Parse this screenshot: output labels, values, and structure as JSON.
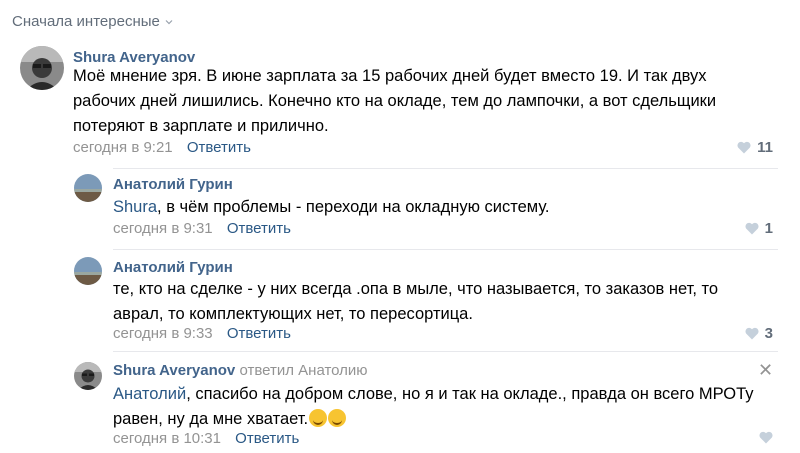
{
  "sort": {
    "label": "Сначала интересные"
  },
  "comments": [
    {
      "author": "Shura Averyanov",
      "lines": [
        "Моё мнение зря. В июне зарплата за 15 рабочих дней будет вместо 19. И так двух",
        "рабочих дней лишились. Конечно кто на окладе, тем до лампочки, а вот сдельщики",
        "потеряют в зарплате и прилично."
      ],
      "time": "сегодня в 9:21",
      "reply": "Ответить",
      "likes": "11"
    },
    {
      "author": "Анатолий Гурин",
      "mention": "Shura",
      "text": ", в чём проблемы - переходи на окладную систему.",
      "time": "сегодня в 9:31",
      "reply": "Ответить",
      "likes": "1"
    },
    {
      "author": "Анатолий Гурин",
      "lines": [
        "те, кто на сделке - у них всегда .опа в мыле, что называется, то заказов нет, то",
        "аврал, то комплектующих нет, то пересортица."
      ],
      "time": "сегодня в 9:33",
      "reply": "Ответить",
      "likes": "3"
    },
    {
      "author": "Shura Averyanov",
      "replied_to": "ответил Анатолию",
      "mention": "Анатолий",
      "line1_rest": ", спасибо на добром слове, но я и так на окладе., правда он всего МРОТу",
      "line2": "равен, ну да мне хватает.",
      "time": "сегодня в 10:31",
      "reply": "Ответить"
    }
  ],
  "icons": {
    "like": "heart-icon",
    "close": "close-icon",
    "sort": "chevron-down-icon"
  },
  "colors": {
    "link": "#2a5885",
    "name": "#42648b",
    "meta": "#939393"
  }
}
